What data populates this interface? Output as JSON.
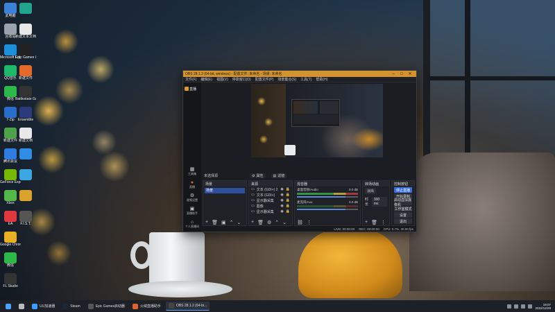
{
  "desktop": {
    "icons_col1": [
      {
        "label": "此电脑",
        "icon": "computer-icon",
        "color": "#3b82d6"
      },
      {
        "label": "回收站",
        "icon": "recycle-bin-icon",
        "color": "#9aa3ad"
      },
      {
        "label": "Microsoft Edge",
        "icon": "edge-icon",
        "color": "#1d8fd8"
      },
      {
        "label": "QQ音乐",
        "icon": "qq-music-icon",
        "color": "#1fb86a"
      },
      {
        "label": "微信",
        "icon": "wechat-icon",
        "color": "#2db84a"
      },
      {
        "label": "7-Zip",
        "icon": "zip-icon",
        "color": "#2a6cc9"
      },
      {
        "label": "新建文件",
        "icon": "file-icon",
        "color": "#4fa24a"
      },
      {
        "label": "腾讯会议",
        "icon": "meeting-icon",
        "color": "#2f7de1"
      },
      {
        "label": "GeForce Experience",
        "icon": "geforce-icon",
        "color": "#76b900"
      },
      {
        "label": "Xbox",
        "icon": "xbox-icon",
        "color": "#53b848"
      },
      {
        "label": "EA",
        "icon": "ea-icon",
        "color": "#e0383e"
      },
      {
        "label": "Google Chrome",
        "icon": "chrome-icon",
        "color": "#e9b024"
      },
      {
        "label": "微信",
        "icon": "wechat-icon",
        "color": "#2db84a"
      },
      {
        "label": "FL Studio",
        "icon": "fl-studio-icon",
        "color": "#333"
      }
    ],
    "icons_col2": [
      {
        "label": "",
        "icon": "app-icon",
        "color": "#22a58f"
      },
      {
        "label": "新建文本文档",
        "icon": "text-file-icon",
        "color": "#e8e8e8"
      },
      {
        "label": "Epic Games Launcher",
        "icon": "epic-icon",
        "color": "#222"
      },
      {
        "label": "新建文件",
        "icon": "doc-icon",
        "color": "#e46a2a"
      },
      {
        "label": "Battlestate Games",
        "icon": "battlestate-icon",
        "color": "#333"
      },
      {
        "label": "Ensemble",
        "icon": "ensemble-icon",
        "color": "#2a3a7a"
      },
      {
        "label": "新建文档",
        "icon": "doc-icon",
        "color": "#e8e8e8"
      },
      {
        "label": "",
        "icon": "app-icon",
        "color": "#2f8de4"
      },
      {
        "label": "",
        "icon": "app-icon",
        "color": "#3aa7e0"
      },
      {
        "label": "",
        "icon": "app-icon",
        "color": "#d7a32a"
      },
      {
        "label": "F.I.S.T.",
        "icon": "game-icon",
        "color": "#555"
      }
    ]
  },
  "obs": {
    "title": "OBS 28.1.2 (64-bit, windows) - 配置文件: 未命名 - 场景: 未命名",
    "menu": [
      "文件(F)",
      "编辑(E)",
      "视图(V)",
      "停靠窗口(D)",
      "配置文件(P)",
      "场景集合(S)",
      "工具(T)",
      "帮助(H)"
    ],
    "brand": "直播",
    "left_nav": [
      {
        "label": "工具箱",
        "icon": "toolbox-icon"
      },
      {
        "label": "直播",
        "icon": "live-icon"
      },
      {
        "label": "视频设置",
        "icon": "settings-icon"
      },
      {
        "label": "直播助手",
        "icon": "assistant-icon"
      },
      {
        "label": "个人直播间",
        "icon": "room-icon"
      }
    ],
    "context": {
      "source_label": "未选择源",
      "props": "属性",
      "filters": "滤镜"
    },
    "scenes": {
      "title": "场景",
      "items": [
        "场景"
      ]
    },
    "sources": {
      "title": "来源",
      "items": [
        "文本 (GDI+) 2",
        "文本 (GDI+)",
        "显示器采集",
        "图像",
        "显示器采集"
      ]
    },
    "mixer": {
      "title": "混音器",
      "tracks": [
        {
          "name": "桌面音频/Audio",
          "db": "0.0 dB",
          "level": 0.72,
          "volume": 0.8
        },
        {
          "name": "麦克风/Aux",
          "db": "0.0 dB",
          "level": 0.0,
          "volume": 0.8
        }
      ]
    },
    "transitions": {
      "title": "转场动画",
      "type": "淡出",
      "duration_label": "时长",
      "duration": "300 ms"
    },
    "controls": {
      "title": "控制按钮",
      "buttons": [
        "停止直播",
        "开始录制",
        "启动虚拟摄像机",
        "工作室模式",
        "设置",
        "退出"
      ]
    },
    "status": {
      "live": "LIVE: 00:00:00",
      "rec": "REC: 00:00:00",
      "cpu": "CPU: 0.7%, 30.00 fps"
    }
  },
  "taskbar": {
    "apps": [
      {
        "label": "",
        "icon": "start-icon",
        "color": "#4aa3ff"
      },
      {
        "label": "",
        "icon": "search-icon",
        "color": "#bbb"
      },
      {
        "label": "UU加速器",
        "icon": "uu-icon",
        "color": "#3aa0ff"
      },
      {
        "label": "Steam",
        "icon": "steam-icon",
        "color": "#1b2838"
      },
      {
        "label": "Epic Games启动器",
        "icon": "epic-icon",
        "color": "#555"
      },
      {
        "label": "火绒直播助手",
        "icon": "live-helper-icon",
        "color": "#e0632a"
      },
      {
        "label": "OBS 28.1.2 (64-bi...",
        "icon": "obs-icon",
        "color": "#444"
      }
    ],
    "clock": {
      "time": "19:07",
      "date": "2022/12/29"
    }
  }
}
